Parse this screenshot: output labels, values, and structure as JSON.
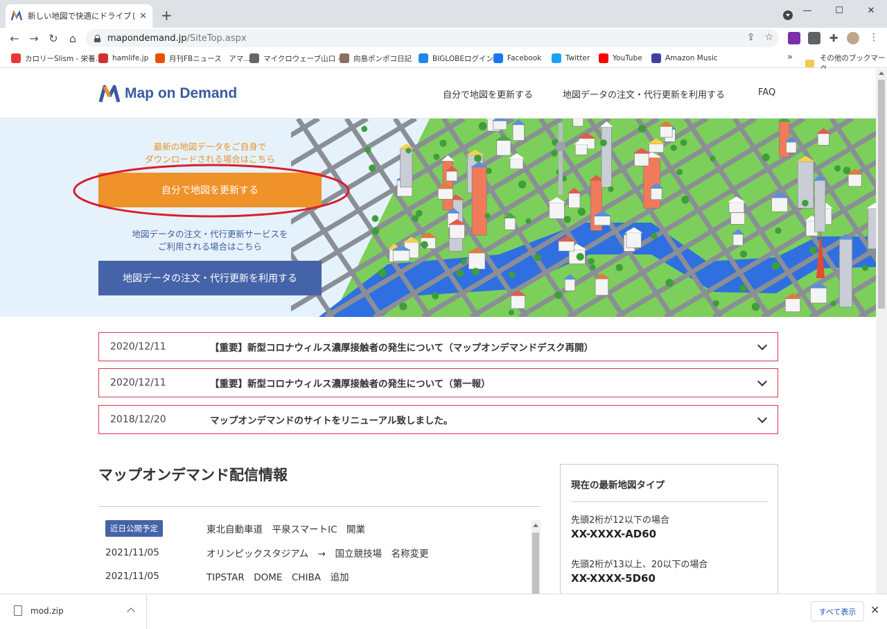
{
  "browser": {
    "tab_title": "新しい地図で快適にドライブしよう !!",
    "tab_close": "✕",
    "new_tab": "+",
    "url_host": "mapondemand.jp",
    "url_path": "/SiteTop.aspx",
    "window_controls": [
      "—",
      "☐",
      "✕"
    ],
    "bookmarks": [
      {
        "label": "カロリーSlism - 栄養...",
        "color": "#e53935"
      },
      {
        "label": "hamlife.jp",
        "color": "#d32f2f"
      },
      {
        "label": "月刊FBニュース　アマ...",
        "color": "#e65100"
      },
      {
        "label": "マイクロウェーブ山口 -...",
        "color": "#666666"
      },
      {
        "label": "向島ポンポコ日記",
        "color": "#8d6e63"
      },
      {
        "label": "BIGLOBEログイン",
        "color": "#1e88e5"
      },
      {
        "label": "Facebook",
        "color": "#1877f2"
      },
      {
        "label": "Twitter",
        "color": "#1da1f2"
      },
      {
        "label": "YouTube",
        "color": "#ff0000"
      },
      {
        "label": "Amazon Music",
        "color": "#3f3fa8"
      }
    ],
    "bookmarks_more": "»",
    "other_bookmarks": "その他のブックマーク"
  },
  "site": {
    "logo_text": "Map on Demand",
    "nav": [
      "自分で地図を更新する",
      "地図データの注文・代行更新を利用する",
      "FAQ"
    ]
  },
  "hero": {
    "caption_self": [
      "最新の地図データをご自身で",
      "ダウンロードされる場合はこちら"
    ],
    "button_self": "自分で地図を更新する",
    "caption_order": [
      "地図データの注文・代行更新サービスを",
      "ご利用される場合はこちら"
    ],
    "button_order": "地図データの注文・代行更新を利用する"
  },
  "news": [
    {
      "date": "2020/12/11",
      "title": "【重要】新型コロナウィルス濃厚接触者の発生について（マップオンデマンドデスク再開）"
    },
    {
      "date": "2020/12/11",
      "title": "【重要】新型コロナウィルス濃厚接触者の発生について（第一報）"
    },
    {
      "date": "2018/12/20",
      "title": "マップオンデマンドのサイトをリニューアル致しました。"
    }
  ],
  "distribution": {
    "title": "マップオンデマンド配信情報",
    "items": [
      {
        "date": "近日公開予定",
        "badge": true,
        "text": "東北自動車道　平泉スマートIC　開業"
      },
      {
        "date": "2021/11/05",
        "badge": false,
        "text": "オリンピックスタジアム　→　国立競技場　名称変更"
      },
      {
        "date": "2021/11/05",
        "badge": false,
        "text": "TIPSTAR　DOME　CHIBA　追加"
      }
    ]
  },
  "latest_map": {
    "heading": "現在の最新地図タイプ",
    "entries": [
      {
        "condition": "先頭2桁が12以下の場合",
        "code": "XX-XXXX-AD60"
      },
      {
        "condition": "先頭2桁が13以上、20以下の場合",
        "code": "XX-XXXX-5D60"
      }
    ]
  },
  "download": {
    "file": "mod.zip",
    "show_all": "すべて表示",
    "close": "✕"
  },
  "colors": {
    "brand_blue": "#4563a8",
    "orange": "#f0922a",
    "news_border": "#e0324b",
    "annotation_red": "#d81e2c"
  }
}
